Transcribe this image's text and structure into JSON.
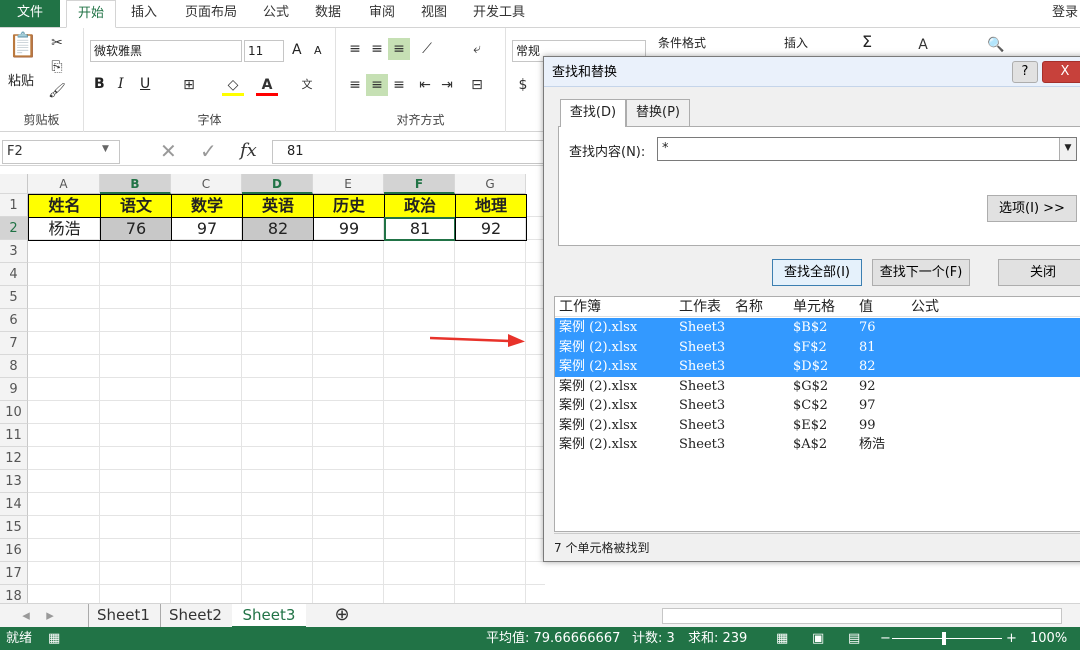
{
  "ribbon_tabs": [
    "文件",
    "开始",
    "插入",
    "页面布局",
    "公式",
    "数据",
    "审阅",
    "视图",
    "开发工具"
  ],
  "login": "登录",
  "clipboard": {
    "paste": "粘贴",
    "label": "剪贴板"
  },
  "font": {
    "name": "微软雅黑",
    "size": "11",
    "label": "字体",
    "bold": "B",
    "italic": "I",
    "underline": "U",
    "grow": "A",
    "shrink": "A"
  },
  "align": {
    "label": "对齐方式"
  },
  "number": {
    "format": "常规"
  },
  "styles": {
    "cond": "条件格式",
    "insert": "插入",
    "sigma": "Σ"
  },
  "name_box": "F2",
  "formula_value": "81",
  "fx": "fx",
  "columns": [
    "A",
    "B",
    "C",
    "D",
    "E",
    "F",
    "G"
  ],
  "rows": [
    "1",
    "2",
    "3",
    "4",
    "5",
    "6",
    "7",
    "8",
    "9",
    "10",
    "11",
    "12",
    "13",
    "14",
    "15",
    "16",
    "17",
    "18"
  ],
  "headers": [
    "姓名",
    "语文",
    "数学",
    "英语",
    "历史",
    "政治",
    "地理"
  ],
  "values": [
    "杨浩",
    "76",
    "97",
    "82",
    "99",
    "81",
    "92"
  ],
  "sheets": [
    "Sheet1",
    "Sheet2",
    "Sheet3"
  ],
  "status": {
    "ready": "就绪",
    "average": "平均值: 79.66666667",
    "count": "计数: 3",
    "sum": "求和: 239",
    "zoom": "100%"
  },
  "dialog": {
    "title": "查找和替换",
    "tab_find": "查找(D)",
    "tab_replace": "替换(P)",
    "find_label": "查找内容(N):",
    "find_value": "*",
    "options": "选项(I) >>",
    "find_all": "查找全部(I)",
    "find_next": "查找下一个(F)",
    "close": "关闭",
    "help": "?",
    "x": "X",
    "result_headers": [
      "工作簿",
      "工作表",
      "名称",
      "单元格",
      "值",
      "公式"
    ],
    "results": [
      {
        "book": "案例 (2).xlsx",
        "sheet": "Sheet3",
        "cell": "$B$2",
        "value": "76",
        "selected": true
      },
      {
        "book": "案例 (2).xlsx",
        "sheet": "Sheet3",
        "cell": "$F$2",
        "value": "81",
        "selected": true
      },
      {
        "book": "案例 (2).xlsx",
        "sheet": "Sheet3",
        "cell": "$D$2",
        "value": "82",
        "selected": true
      },
      {
        "book": "案例 (2).xlsx",
        "sheet": "Sheet3",
        "cell": "$G$2",
        "value": "92",
        "selected": false
      },
      {
        "book": "案例 (2).xlsx",
        "sheet": "Sheet3",
        "cell": "$C$2",
        "value": "97",
        "selected": false
      },
      {
        "book": "案例 (2).xlsx",
        "sheet": "Sheet3",
        "cell": "$E$2",
        "value": "99",
        "selected": false
      },
      {
        "book": "案例 (2).xlsx",
        "sheet": "Sheet3",
        "cell": "$A$2",
        "value": "杨浩",
        "selected": false
      }
    ],
    "footer": "7 个单元格被找到"
  },
  "colors": {
    "excel_green": "#217346",
    "header_yellow": "#ffff00",
    "selected_gray": "#c8c8c8",
    "highlight_blue": "#3399ff",
    "arrow_red": "#e8322a"
  }
}
